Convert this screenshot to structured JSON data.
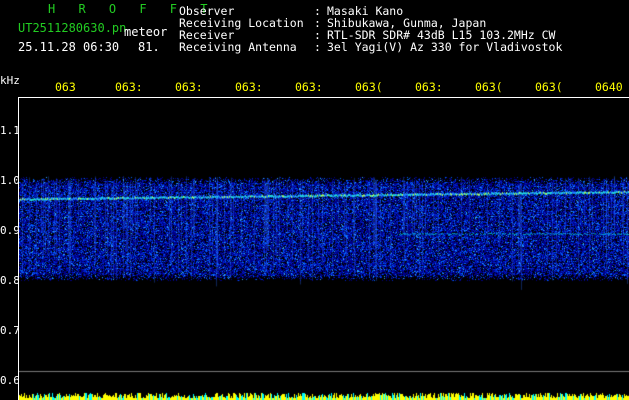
{
  "header": {
    "app_title": "H R O F F T",
    "filename": "UT2511280630.pn",
    "type_label": "meteor",
    "timestamp": "25.11.28 06:30",
    "count": "81.",
    "info": [
      {
        "label": "Observer",
        "sep": ":",
        "value": "Masaki Kano"
      },
      {
        "label": "Receiving Location",
        "sep": ":",
        "value": "Shibukawa, Gunma, Japan"
      },
      {
        "label": "Receiver",
        "sep": ":",
        "value": "RTL-SDR SDR# 43dB L15 103.2MHz CW"
      },
      {
        "label": "Receiving Antenna",
        "sep": ":",
        "value": "3el Yagi(V) Az 330 for Vladivostok"
      }
    ]
  },
  "chart_data": {
    "type": "heatmap",
    "ylabel": "kHz",
    "y_ticks": [
      "1.1",
      "1.0",
      "0.9",
      "0.8",
      "0.7",
      "0.6"
    ],
    "x_ticks": [
      "063",
      "063:",
      "063:",
      "063:",
      "063:",
      "063(",
      "063:",
      "063(",
      "063(",
      "0640"
    ],
    "ylim": [
      0.58,
      1.2
    ],
    "signal_band": [
      0.8,
      1.01
    ],
    "carrier_line": 0.965,
    "secondary_line": 0.895,
    "reference_line": 0.62,
    "colors": {
      "low": "#0000a0",
      "mid": "#0050ff",
      "high": "#00ffff",
      "peak": "#aaff55",
      "bottom_bars": "#ffff00",
      "bottom_bars_alt": "#00ffff"
    }
  }
}
